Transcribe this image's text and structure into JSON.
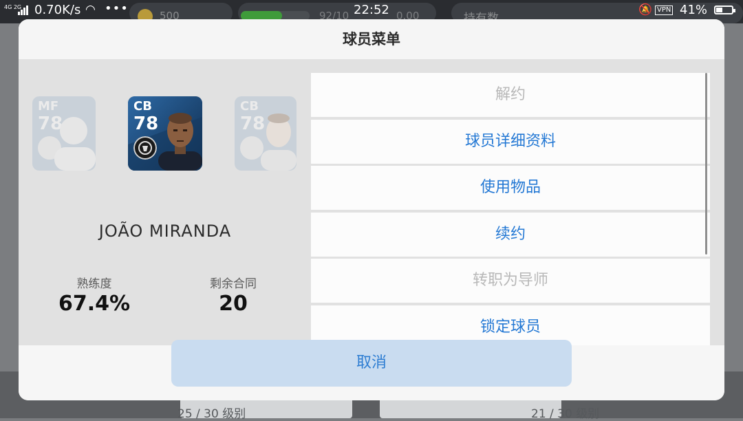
{
  "status_bar": {
    "network_tags": "4G 2G",
    "speed": "0.70K/s",
    "more": "•••",
    "time": "22:52",
    "vpn": "VPN",
    "battery": "41%",
    "battery_level": 0.41
  },
  "background": {
    "coins": "500",
    "team_label": "持有数",
    "slot_text_1": "92/10",
    "slot_text_2": "0.00",
    "level_left": "25 / 30 级别",
    "level_right": "21 / 30 级别"
  },
  "dialog": {
    "title": "球员菜单",
    "cancel_label": "取消"
  },
  "player": {
    "name": "JOÃO MIRANDA",
    "prev_card": {
      "position": "MF",
      "rating": "78"
    },
    "main_card": {
      "position": "CB",
      "rating": "78"
    },
    "next_card": {
      "position": "CB",
      "rating": "78"
    },
    "proficiency_label": "熟练度",
    "proficiency_value": "67.4%",
    "contract_label": "剩余合同",
    "contract_value": "20"
  },
  "menu": {
    "items": [
      {
        "label": "解约",
        "enabled": false
      },
      {
        "label": "球员详细资料",
        "enabled": true
      },
      {
        "label": "使用物品",
        "enabled": true
      },
      {
        "label": "续约",
        "enabled": true
      },
      {
        "label": "转职为导师",
        "enabled": false
      },
      {
        "label": "锁定球员",
        "enabled": true
      }
    ]
  },
  "colors": {
    "accent": "#2378d4",
    "disabled": "#b8b8b8",
    "cancel_bg": "#c9dcf0"
  }
}
